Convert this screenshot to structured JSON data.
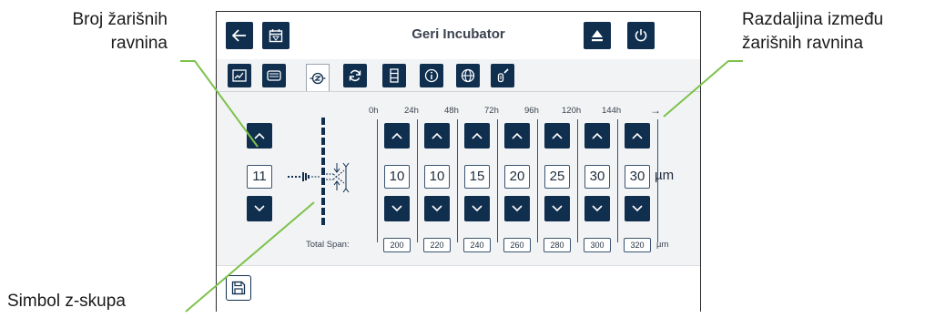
{
  "callouts": {
    "planes_count_line1": "Broj žarišnih",
    "planes_count_line2": "ravnina",
    "distance_line1": "Razdaljina između",
    "distance_line2": "žarišnih ravnina",
    "symbol": "Simbol z-skupa"
  },
  "header": {
    "title": "Geri Incubator"
  },
  "tabs": [
    "chart-icon",
    "incubator-icon",
    "focus-z-icon",
    "refresh-icon",
    "stack-icon",
    "info-icon",
    "globe-icon",
    "tool-icon"
  ],
  "zstack": {
    "planes_value": "11",
    "time_labels": [
      "0h",
      "24h",
      "48h",
      "72h",
      "96h",
      "120h",
      "144h"
    ],
    "distances": [
      "10",
      "10",
      "15",
      "20",
      "25",
      "30",
      "30"
    ],
    "distance_unit": "µm",
    "total_span_label": "Total Span:",
    "spans": [
      "200",
      "220",
      "240",
      "260",
      "280",
      "300",
      "320"
    ],
    "span_unit": "µm"
  },
  "colors": {
    "button": "#102f4f",
    "panel": "#f2f3f4",
    "callout_line": "#7dc24b"
  }
}
